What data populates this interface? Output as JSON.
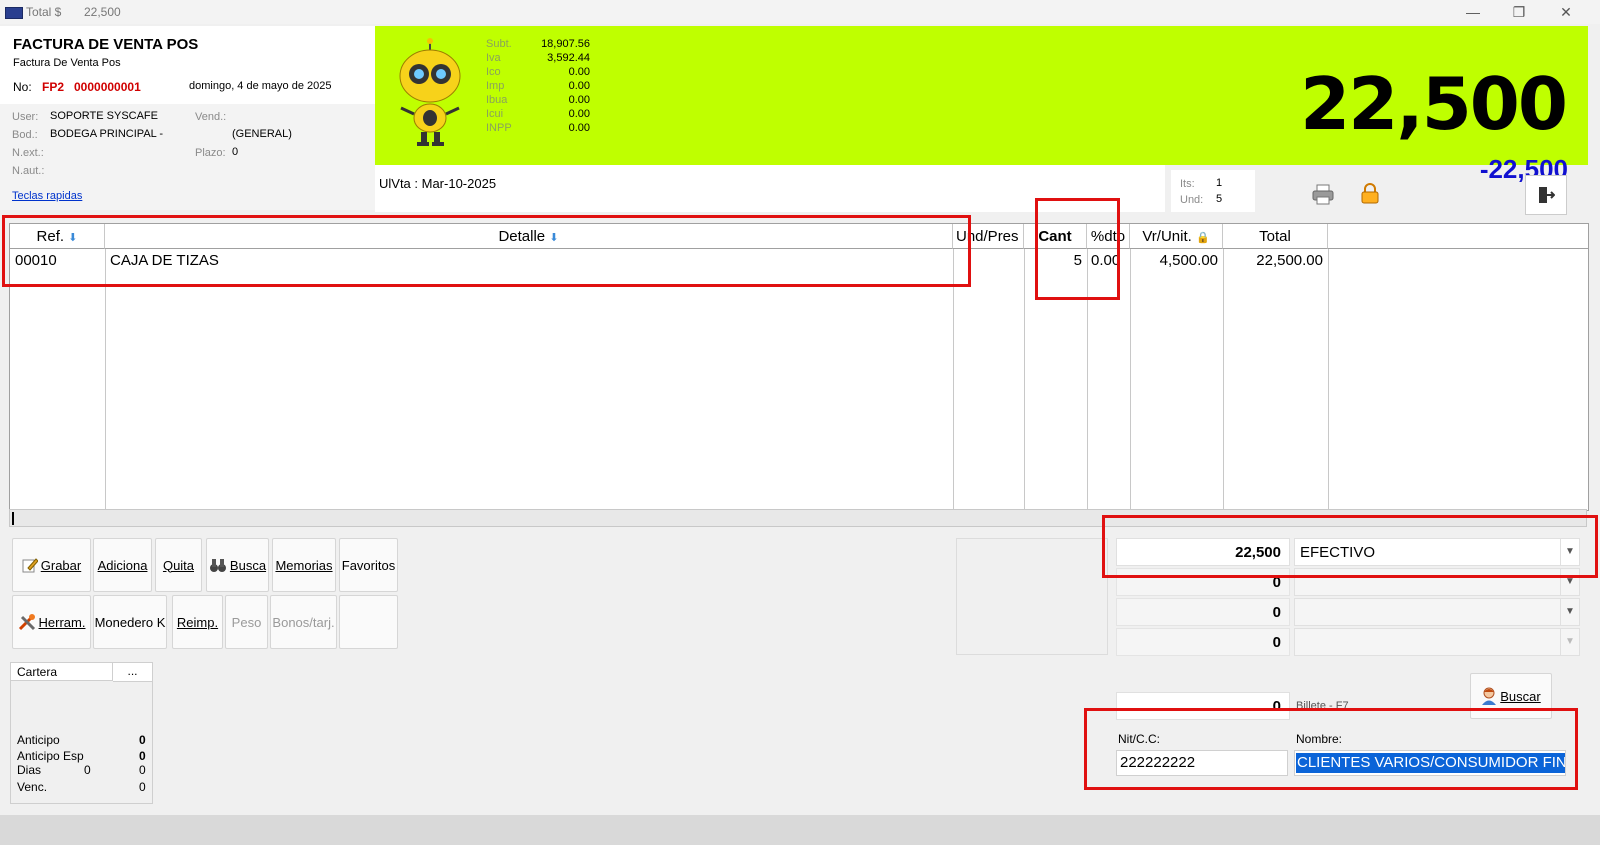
{
  "window": {
    "title": "Total $",
    "title_value": "22,500",
    "minimize": "—",
    "restore": "❐",
    "close": "✕"
  },
  "header": {
    "doc_title": "FACTURA DE VENTA POS",
    "doc_subtitle": "Factura De Venta Pos",
    "no_label": "No:",
    "prefix": "FP2",
    "number": "0000000001",
    "date": "domingo, 4 de mayo de 2025",
    "user_label": "User:",
    "user_value": "SOPORTE SYSCAFE",
    "vend_label": "Vend.:",
    "bod_label": "Bod.:",
    "bod_value": "BODEGA PRINCIPAL -",
    "general": "(GENERAL)",
    "next_label": "N.ext.:",
    "plazo_label": "Plazo:",
    "plazo_value": "0",
    "naut_label": "N.aut.:",
    "shortcuts_link": "Teclas rapidas"
  },
  "totals": {
    "items": [
      {
        "label": "Subt.",
        "value": "18,907.56"
      },
      {
        "label": "Iva",
        "value": "3,592.44"
      },
      {
        "label": "Ico",
        "value": "0.00"
      },
      {
        "label": "Imp",
        "value": "0.00"
      },
      {
        "label": "Ibua",
        "value": "0.00"
      },
      {
        "label": "Icui",
        "value": "0.00"
      },
      {
        "label": "INPP",
        "value": "0.00"
      }
    ],
    "big_total": "22,500",
    "balance": "-22,500"
  },
  "info": {
    "last_sale": "UlVta : Mar-10-2025",
    "its_label": "Its:",
    "its_value": "1",
    "und_label": "Und:",
    "und_value": "5"
  },
  "grid": {
    "headers": {
      "ref": "Ref.",
      "detalle": "Detalle",
      "und": "Und/Pres",
      "cant": "Cant",
      "dto": "%dto",
      "vrunit": "Vr/Unit.",
      "total": "Total"
    },
    "rows": [
      {
        "ref": "00010",
        "detalle": "CAJA DE TIZAS",
        "und": "",
        "cant": "5",
        "dto": "0.00",
        "vrunit": "4,500.00",
        "total": "22,500.00"
      }
    ]
  },
  "buttons": {
    "grabar": "Grabar",
    "adiciona": "Adiciona",
    "quita": "Quita",
    "busca": "Busca",
    "memorias": "Memorias",
    "favoritos": "Favoritos",
    "herram": "Herram.",
    "monedero": "Monedero K",
    "reimp": "Reimp.",
    "peso": "Peso",
    "bonos": "Bonos/tarj."
  },
  "cartera": {
    "title": "Cartera",
    "more": "...",
    "anticipo_label": "Anticipo",
    "anticipo_value": "0",
    "anticipo_esp_label": "Anticipo Esp",
    "anticipo_esp_value": "0",
    "dias_label": "Dias",
    "dias_value1": "0",
    "dias_value2": "0",
    "venc_label": "Venc.",
    "venc_value": "0"
  },
  "payment": {
    "rows": [
      {
        "amount": "22,500",
        "method": "EFECTIVO"
      },
      {
        "amount": "0",
        "method": ""
      },
      {
        "amount": "0",
        "method": ""
      },
      {
        "amount": "0",
        "method": ""
      }
    ],
    "billetes_amount": "0",
    "billetes_label": "Billete - F7"
  },
  "customer": {
    "nit_label": "Nit/C.C:",
    "nit_value": "222222222",
    "name_label": "Nombre:",
    "name_value": "CLIENTES VARIOS/CONSUMIDOR FIN",
    "buscar": "Buscar"
  }
}
